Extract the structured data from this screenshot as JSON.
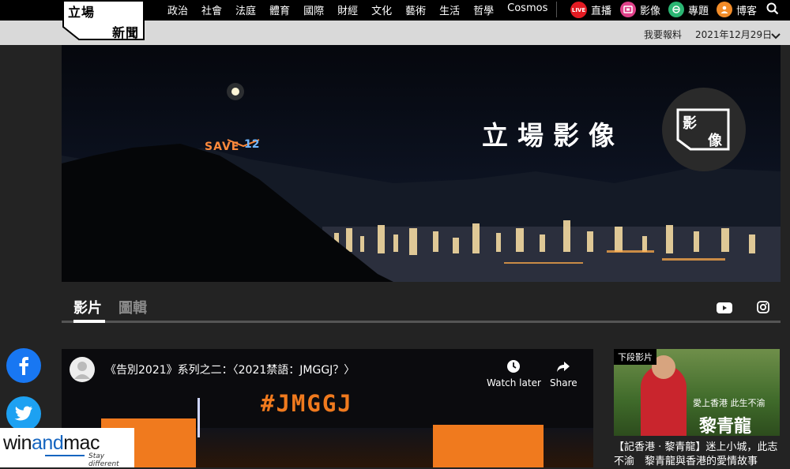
{
  "logo": {
    "line1": "立場",
    "line2": "新聞"
  },
  "nav": {
    "items": [
      "政治",
      "社會",
      "法庭",
      "體育",
      "國際",
      "財經",
      "文化",
      "藝術",
      "生活",
      "哲學",
      "Cosmos"
    ],
    "live_badge": "LIVE",
    "live_label": "直播",
    "media_label": "影像",
    "topics_label": "專題",
    "blog_label": "博客"
  },
  "subbar": {
    "report": "我要報料",
    "date": "2021年12月29日"
  },
  "hero": {
    "title": "立場影像",
    "badge_line1": "影",
    "badge_line2": "像",
    "save_sign": "SAVE",
    "sign_number": "12"
  },
  "tabs": {
    "active": "影片",
    "inactive": "圖輯"
  },
  "video": {
    "title": "《告別2021》系列之二：〈2021禁語：JMGGJ？〉",
    "watch_later": "Watch later",
    "share": "Share",
    "hashtag": "#JMGGJ"
  },
  "next_video": {
    "label": "下段影片",
    "caption_small": "愛上香港  此生不渝",
    "caption_name": "黎青龍",
    "title": "【記香港 · 黎青龍】迷上小城，此志不渝　黎青龍與香港的愛情故事"
  },
  "watermark": {
    "brand_a": "win",
    "brand_b": "and",
    "brand_c": "mac",
    "tagline": "Stay different"
  },
  "colors": {
    "live_red": "#e31b23",
    "media_pink": "#e0418a",
    "topics_green": "#2bb673",
    "blog_orange": "#f28c28",
    "facebook": "#1877f2",
    "twitter": "#1da1f2"
  }
}
